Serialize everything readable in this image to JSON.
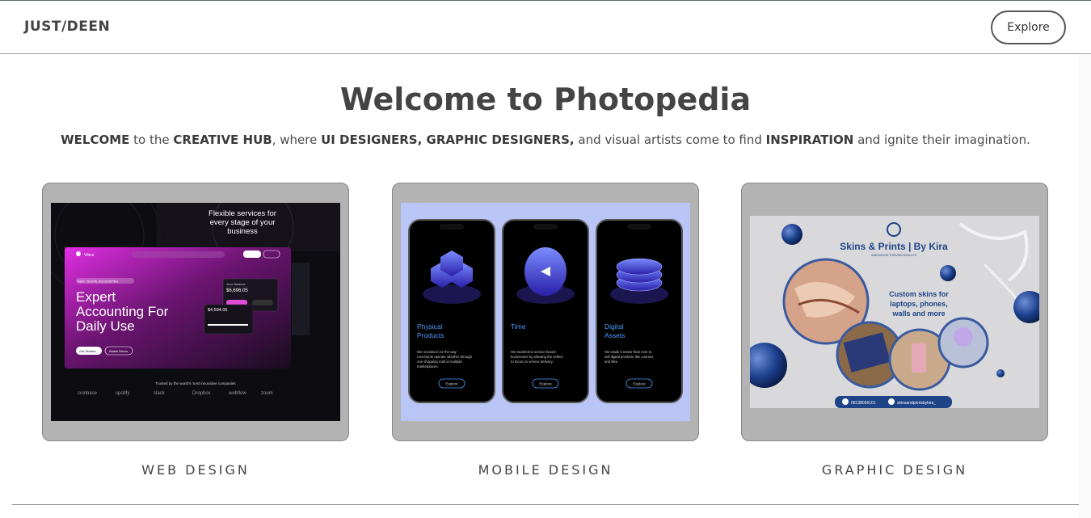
{
  "header": {
    "brand": "JUST/DEEN",
    "explore_label": "Explore"
  },
  "hero": {
    "title": "Welcome to Photopedia",
    "lead": [
      {
        "t": "WELCOME",
        "b": true
      },
      {
        "t": " to the ",
        "b": false
      },
      {
        "t": "CREATIVE HUB",
        "b": true
      },
      {
        "t": ", where ",
        "b": false
      },
      {
        "t": "UI DESIGNERS, GRAPHIC DESIGNERS,",
        "b": true
      },
      {
        "t": " and visual artists come to find ",
        "b": false
      },
      {
        "t": "INSPIRATION",
        "b": true
      },
      {
        "t": " and ignite their imagination.",
        "b": false
      }
    ]
  },
  "cards": [
    {
      "caption": "WEB DESIGN",
      "web": {
        "nav_brand": "Vibes",
        "badge": "NEW - DIGITAL ACCOUNTING",
        "headline": [
          "Expert",
          "Accounting For",
          "Daily Use"
        ],
        "btn1": "Get Started",
        "btn2": "Watch Demo",
        "banner": "Flexible services for every stage of your business",
        "trusted": "Trusted by the world's most innovative companies",
        "logos": [
          "coinbase",
          "spotify",
          "slack",
          "Dropbox",
          "webflow",
          "zoom"
        ],
        "balance_label": "Your Balance",
        "balance": "$6,696.05",
        "amount": "$4,594.05"
      }
    },
    {
      "caption": "MOBILE DESIGN",
      "phones": [
        {
          "title": "Physical\nProducts",
          "body": "We revolution ize the way merchants operate whether through one shopping mall or multiple marketplaces.",
          "btn": "Explore"
        },
        {
          "title": "Time",
          "body": "We transforms service based businesses by allowing the sellers to focus on service delivery.",
          "btn": "Explore"
        },
        {
          "title": "Digital\nAssets",
          "body": "We made it easier than ever to sell digital products like courses and files.",
          "btn": "Explore"
        }
      ]
    },
    {
      "caption": "GRAPHIC DESIGN",
      "graphic": {
        "title": "Skins & Prints | By Kira",
        "subtitle": "INNOVATION  THRIVING  RESULTS",
        "tagline": "Custom skins for laptops, phones, walls and more",
        "phone": "08138056101",
        "handle": "skinsandprintsbykira_"
      }
    }
  ],
  "colors": {
    "card_bg": "#b3b3b3",
    "mobile_bg": "#b9c5f7",
    "web_accent": "#c51bc9"
  }
}
